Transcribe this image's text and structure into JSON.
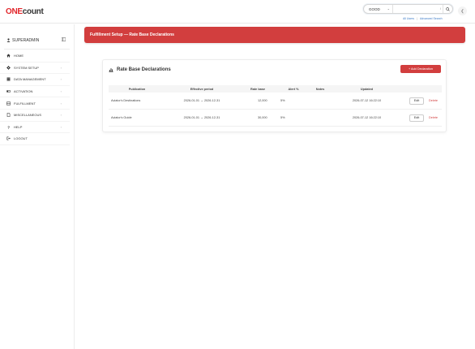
{
  "header": {
    "logo_part1": "ONE",
    "logo_part2": "count",
    "search_scope": "GOOD",
    "quick_link_1": "All Users",
    "quick_link_sep": "|",
    "quick_link_2": "Advanced Search",
    "collapse_glyph": "❮"
  },
  "sidebar": {
    "user": "SUPERADMIN",
    "items": [
      {
        "label": "HOME"
      },
      {
        "label": "SYSTEM SETUP"
      },
      {
        "label": "DATA MANAGEMENT"
      },
      {
        "label": "ACTIVATION"
      },
      {
        "label": "FULFILLMENT"
      },
      {
        "label": "MISCELLANEOUS"
      },
      {
        "label": "HELP"
      },
      {
        "label": "LOGOUT"
      }
    ]
  },
  "main": {
    "banner": "Fulfillment Setup — Rate Base Declarations",
    "card_title": "Rate Base Declarations",
    "add_button": "+ Add Declaration",
    "columns": {
      "publication": "Publication",
      "effective": "Effective period",
      "rate": "Rate base",
      "alert": "Alert %",
      "notes": "Notes",
      "updated": "Updated"
    },
    "rows": [
      {
        "publication": "Aviator's Destinations",
        "effective": "2026-01-01 → 2026-12-31",
        "rate": "12,000",
        "alert": "5%",
        "notes": "",
        "updated": "2026-07-12 16:22:10",
        "edit": "Edit",
        "delete": "Delete"
      },
      {
        "publication": "Aviator's Guide",
        "effective": "2026-01-01 → 2026-12-31",
        "rate": "30,000",
        "alert": "5%",
        "notes": "",
        "updated": "2026-07-12 16:22:10",
        "edit": "Edit",
        "delete": "Delete"
      }
    ]
  },
  "colors": {
    "accent": "#d23e3e",
    "link": "#3b7bc8"
  }
}
